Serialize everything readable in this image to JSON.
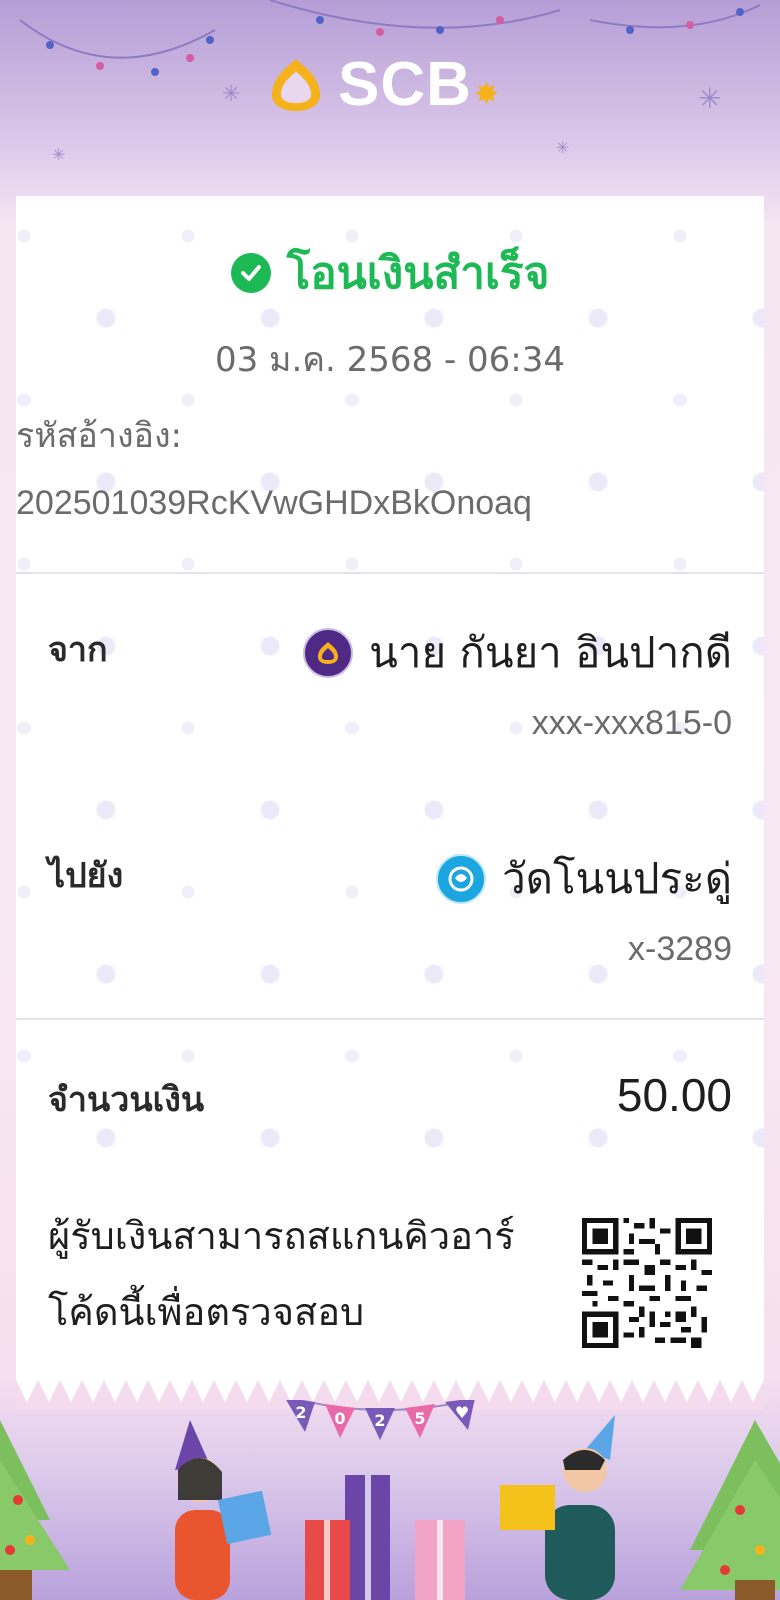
{
  "brand": {
    "logo_text": "SCB"
  },
  "receipt": {
    "status": "โอนเงินสำเร็จ",
    "datetime": "03 ม.ค. 2568 - 06:34",
    "reference_label": "รหัสอ้างอิง:",
    "reference_value": "202501039RcKVwGHDxBkOnoaq",
    "from": {
      "label": "จาก",
      "name": "นาย กันยา อินปากดี",
      "account": "xxx-xxx815-0",
      "bank_icon": "scb-bank-icon"
    },
    "to": {
      "label": "ไปยัง",
      "name": "วัดโนนประดู่",
      "account": "x-3289",
      "bank_icon": "ktb-bank-icon"
    },
    "amount": {
      "label": "จำนวนเงิน",
      "value": "50.00"
    },
    "qr_note": "ผู้รับเงินสามารถสแกนคิวอาร์โค้ดนี้เพื่อตรวจสอบ"
  },
  "decoration": {
    "bunting": [
      "2",
      "0",
      "2",
      "5",
      "♥"
    ]
  },
  "colors": {
    "success": "#1db954",
    "scb_purple": "#4e2a84",
    "ktb_blue": "#1ba5e1",
    "logo_gold": "#f5b21b"
  }
}
